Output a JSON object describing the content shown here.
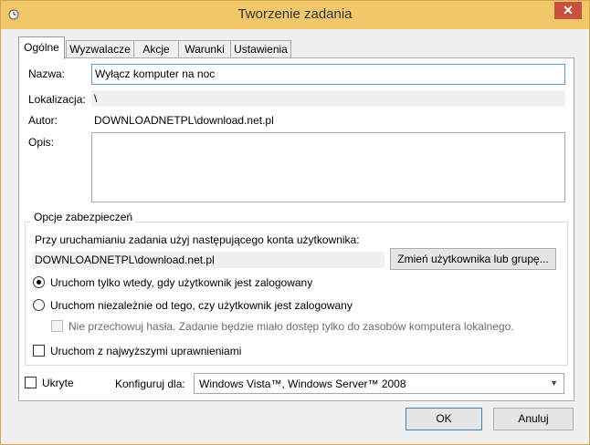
{
  "window": {
    "title": "Tworzenie zadania",
    "close_glyph": "✕"
  },
  "tabs": [
    {
      "label": "Ogólne"
    },
    {
      "label": "Wyzwalacze"
    },
    {
      "label": "Akcje"
    },
    {
      "label": "Warunki"
    },
    {
      "label": "Ustawienia"
    }
  ],
  "general": {
    "name_label": "Nazwa:",
    "name_value": "Wyłącz komputer na noc",
    "location_label": "Lokalizacja:",
    "location_value": "\\",
    "author_label": "Autor:",
    "author_value": "DOWNLOADNETPL\\download.net.pl",
    "description_label": "Opis:",
    "description_value": ""
  },
  "security": {
    "legend": "Opcje zabezpieczeń",
    "account_prompt": "Przy uruchamianiu zadania użyj następującego konta użytkownika:",
    "account_value": "DOWNLOADNETPL\\download.net.pl",
    "change_user_button": "Zmień użytkownika lub grupę...",
    "radio_logged_on": "Uruchom tylko wtedy, gdy użytkownik jest zalogowany",
    "radio_any": "Uruchom niezależnie od tego, czy użytkownik jest zalogowany",
    "no_store_password": "Nie przechowuj hasła. Zadanie będzie miało dostęp tylko do zasobów komputera lokalnego.",
    "highest_privileges": "Uruchom z najwyższymi uprawnieniami",
    "selected_radio": "logged_on"
  },
  "footer": {
    "hidden_label": "Ukryte",
    "configure_label": "Konfiguruj dla:",
    "configure_value": "Windows Vista™, Windows Server™ 2008",
    "ok_button": "OK",
    "cancel_button": "Anuluj"
  },
  "colors": {
    "titlebar": "#f0c86a",
    "close": "#c7503f",
    "focus_border": "#5e9bd6"
  }
}
